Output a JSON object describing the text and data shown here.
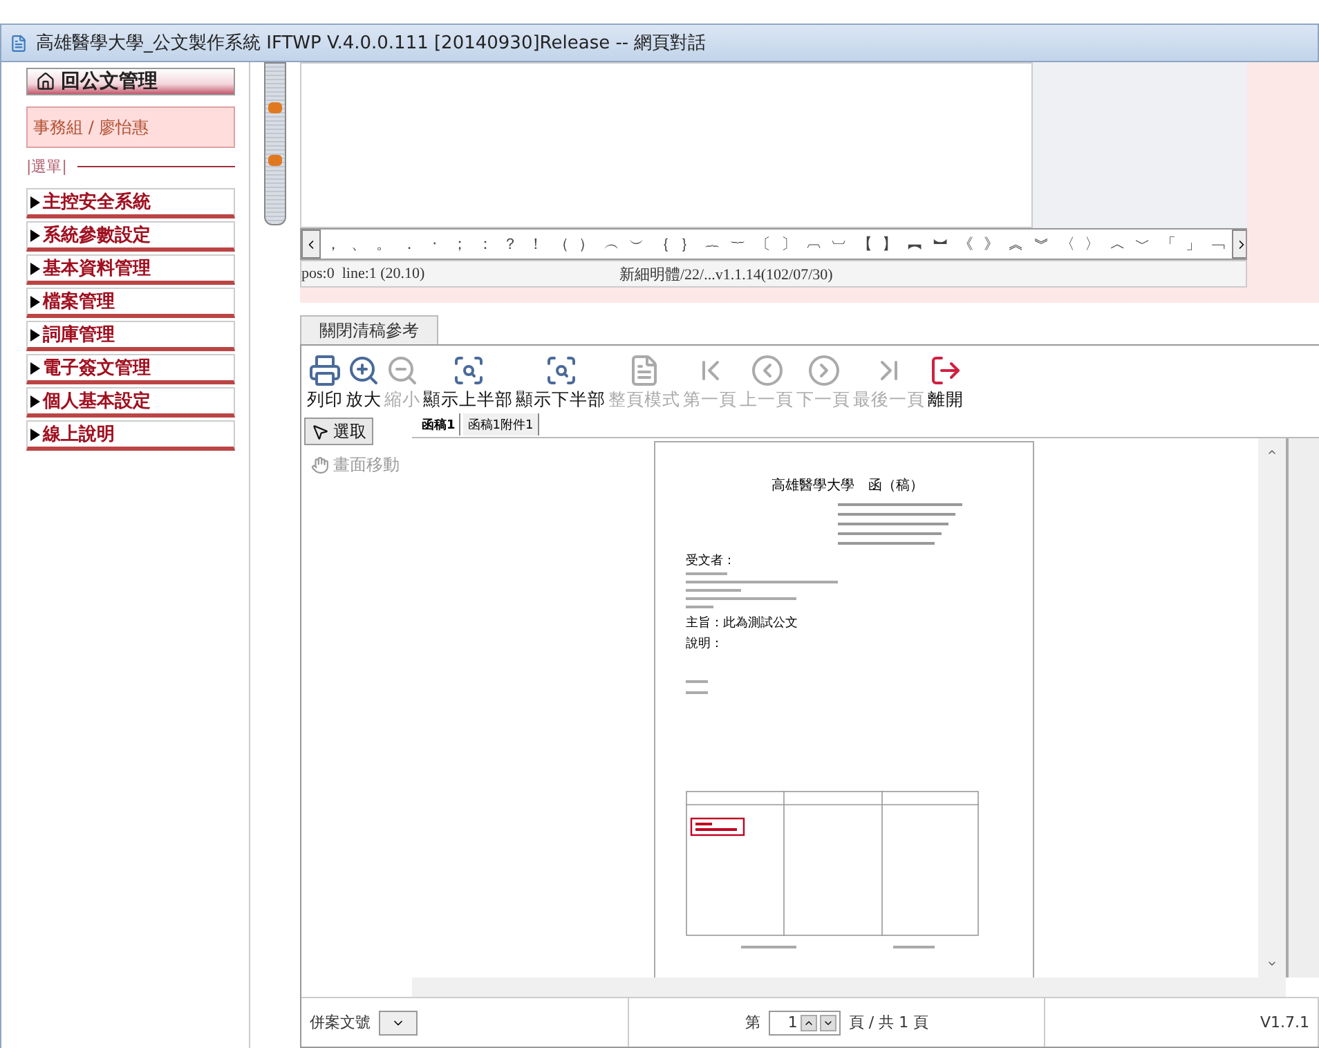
{
  "window": {
    "title": "高雄醫學大學_公文製作系統 IFTWP V.4.0.0.111 [20140930]Release -- 網頁對話"
  },
  "sidebar": {
    "home_button": "回公文管理",
    "user": "事務組 / 廖怡惠",
    "menu_label": "|選單|",
    "items": [
      {
        "label": "主控安全系統"
      },
      {
        "label": "系統參數設定"
      },
      {
        "label": "基本資料管理"
      },
      {
        "label": "檔案管理"
      },
      {
        "label": "詞庫管理"
      },
      {
        "label": "電子簽文管理"
      },
      {
        "label": "個人基本設定"
      },
      {
        "label": "線上說明"
      }
    ]
  },
  "editor": {
    "symbols": [
      "，",
      "、",
      "。",
      "．",
      "‧",
      "；",
      "：",
      "？",
      "！",
      "（",
      "）",
      "︵",
      "︶",
      "｛",
      "｝",
      "︷",
      "︸",
      "〔",
      "〕",
      "︹",
      "︺",
      "【",
      "】",
      "︻",
      "︼",
      "《",
      "》",
      "︽",
      "︾",
      "〈",
      "〉",
      "︿",
      "﹀",
      "「",
      "」",
      "﹁"
    ],
    "status_left": "pos:0  line:1 (20.10)",
    "status_center": "新細明體/22/...v1.1.14(102/07/30)"
  },
  "reference_tab": "關閉清稿參考",
  "viewer": {
    "toolbar": [
      {
        "kind": "print",
        "label": "列印",
        "disabled": false
      },
      {
        "kind": "zoom_in",
        "label": "放大",
        "disabled": false
      },
      {
        "kind": "zoom_out",
        "label": "縮小",
        "disabled": true
      },
      {
        "kind": "top_half",
        "label": "顯示上半部",
        "disabled": false
      },
      {
        "kind": "bottom_half",
        "label": "顯示下半部",
        "disabled": false
      },
      {
        "kind": "full_page",
        "label": "整頁模式",
        "disabled": true
      },
      {
        "kind": "first",
        "label": "第一頁",
        "disabled": true
      },
      {
        "kind": "prev",
        "label": "上一頁",
        "disabled": true
      },
      {
        "kind": "next",
        "label": "下一頁",
        "disabled": true
      },
      {
        "kind": "last",
        "label": "最後一頁",
        "disabled": true
      },
      {
        "kind": "exit",
        "label": "離開",
        "disabled": false
      }
    ],
    "tools": [
      {
        "kind": "select",
        "label": "選取",
        "selected": true
      },
      {
        "kind": "pan",
        "label": "畫面移動",
        "selected": false
      }
    ],
    "doc_tabs": [
      {
        "label": "函稿1",
        "selected": true
      },
      {
        "label": "函稿1附件1",
        "selected": false
      }
    ],
    "document": {
      "heading": "高雄醫學大學　函（稿）",
      "recipient": "受文者：",
      "subject": "主旨：此為測試公文",
      "description": "說明："
    }
  },
  "status_bar": {
    "merge_label": "併案文號",
    "page_prefix": "第",
    "page_value": "1",
    "page_suffix": "頁 / 共 1 頁",
    "version": "V1.7.1"
  }
}
